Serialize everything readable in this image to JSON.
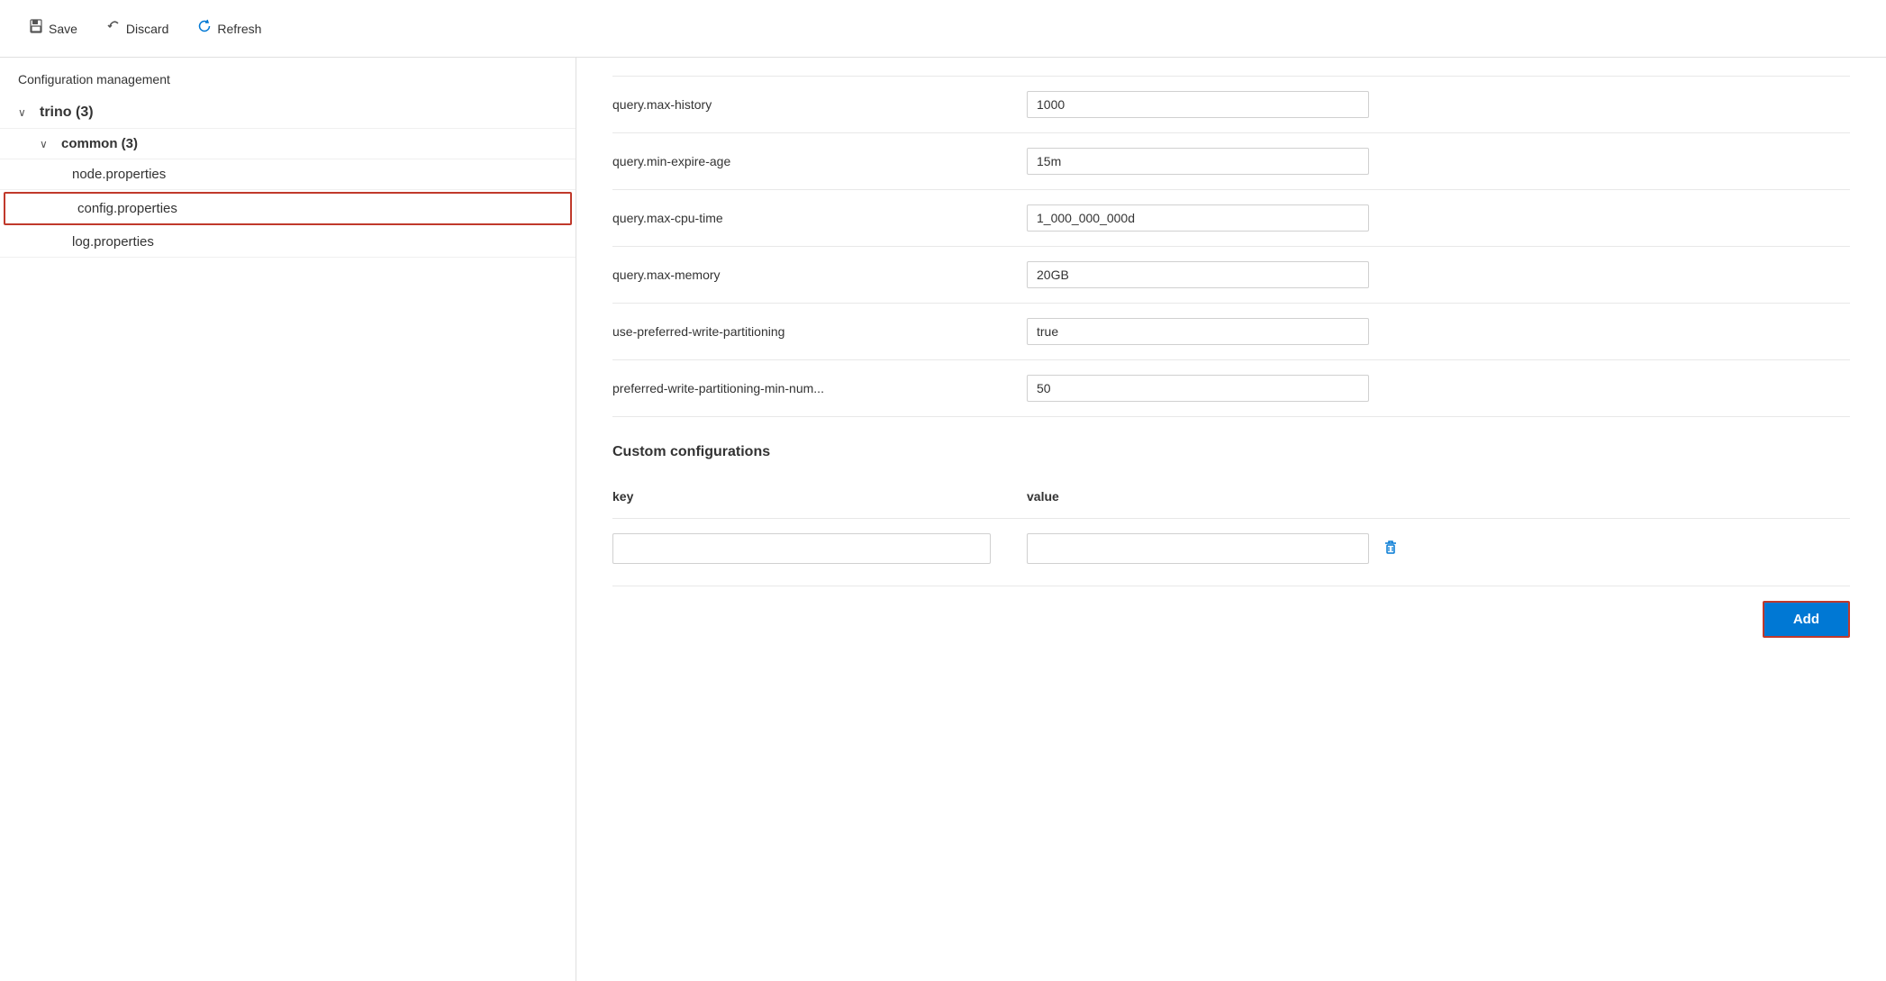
{
  "toolbar": {
    "save_label": "Save",
    "discard_label": "Discard",
    "refresh_label": "Refresh"
  },
  "sidebar": {
    "header": "Configuration management",
    "tree": [
      {
        "id": "trino",
        "label": "trino (3)",
        "level": 0,
        "expanded": true,
        "chevron": "∨"
      },
      {
        "id": "common",
        "label": "common (3)",
        "level": 1,
        "expanded": true,
        "chevron": "∨"
      },
      {
        "id": "node-properties",
        "label": "node.properties",
        "level": 2,
        "selected": false
      },
      {
        "id": "config-properties",
        "label": "config.properties",
        "level": 2,
        "selected": true
      },
      {
        "id": "log-properties",
        "label": "log.properties",
        "level": 2,
        "selected": false
      }
    ]
  },
  "config_rows": [
    {
      "key": "query.max-history",
      "value": "1000"
    },
    {
      "key": "query.min-expire-age",
      "value": "15m"
    },
    {
      "key": "query.max-cpu-time",
      "value": "1_000_000_000d"
    },
    {
      "key": "query.max-memory",
      "value": "20GB"
    },
    {
      "key": "use-preferred-write-partitioning",
      "value": "true"
    },
    {
      "key": "preferred-write-partitioning-min-num...",
      "value": "50"
    }
  ],
  "custom_config": {
    "title": "Custom configurations",
    "key_header": "key",
    "value_header": "value",
    "rows": [
      {
        "key": "",
        "value": ""
      }
    ],
    "add_label": "Add"
  }
}
